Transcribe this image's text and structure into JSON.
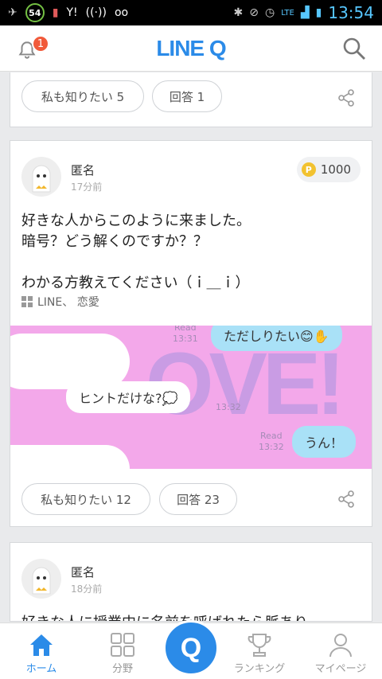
{
  "status_bar": {
    "badge": "54",
    "carrier": "Y!",
    "lte": "LTE",
    "time": "13:54"
  },
  "header": {
    "logo": "LINE Q",
    "notification_count": "1"
  },
  "top_card": {
    "want_to_know": "私も知りたい 5",
    "answers": "回答 1"
  },
  "question": {
    "user": "匿名",
    "time_ago": "17分前",
    "points": "1000",
    "body": [
      "好きな人からこのように来ました。",
      "暗号？どう解くのですか？？",
      "",
      "わかる方教えてください（ｉ＿ｉ）"
    ],
    "tags": "LINE、 恋愛",
    "image": {
      "bubble_top": "ただしりたい😊✋",
      "bubble_hint": "ヒントだけな?💭",
      "bubble_un": "うん！",
      "read_top": "Read",
      "read_time_top": "13:31",
      "time_mid": "13:32",
      "read_bottom": "Read",
      "read_time_bottom": "13:32"
    },
    "want_to_know": "私も知りたい 12",
    "answers": "回答 23"
  },
  "next_question": {
    "user": "匿名",
    "time_ago": "18分前",
    "body_preview": "好きな人に授業中に名前を呼ばれたら脈あり"
  },
  "bottom_nav": {
    "home": "ホーム",
    "category": "分野",
    "ask": "Q",
    "ranking": "ランキング",
    "mypage": "マイページ"
  },
  "colors": {
    "brand": "#2b8be8",
    "badge": "#f15a3a",
    "image_bg": "#f3a8ea"
  }
}
